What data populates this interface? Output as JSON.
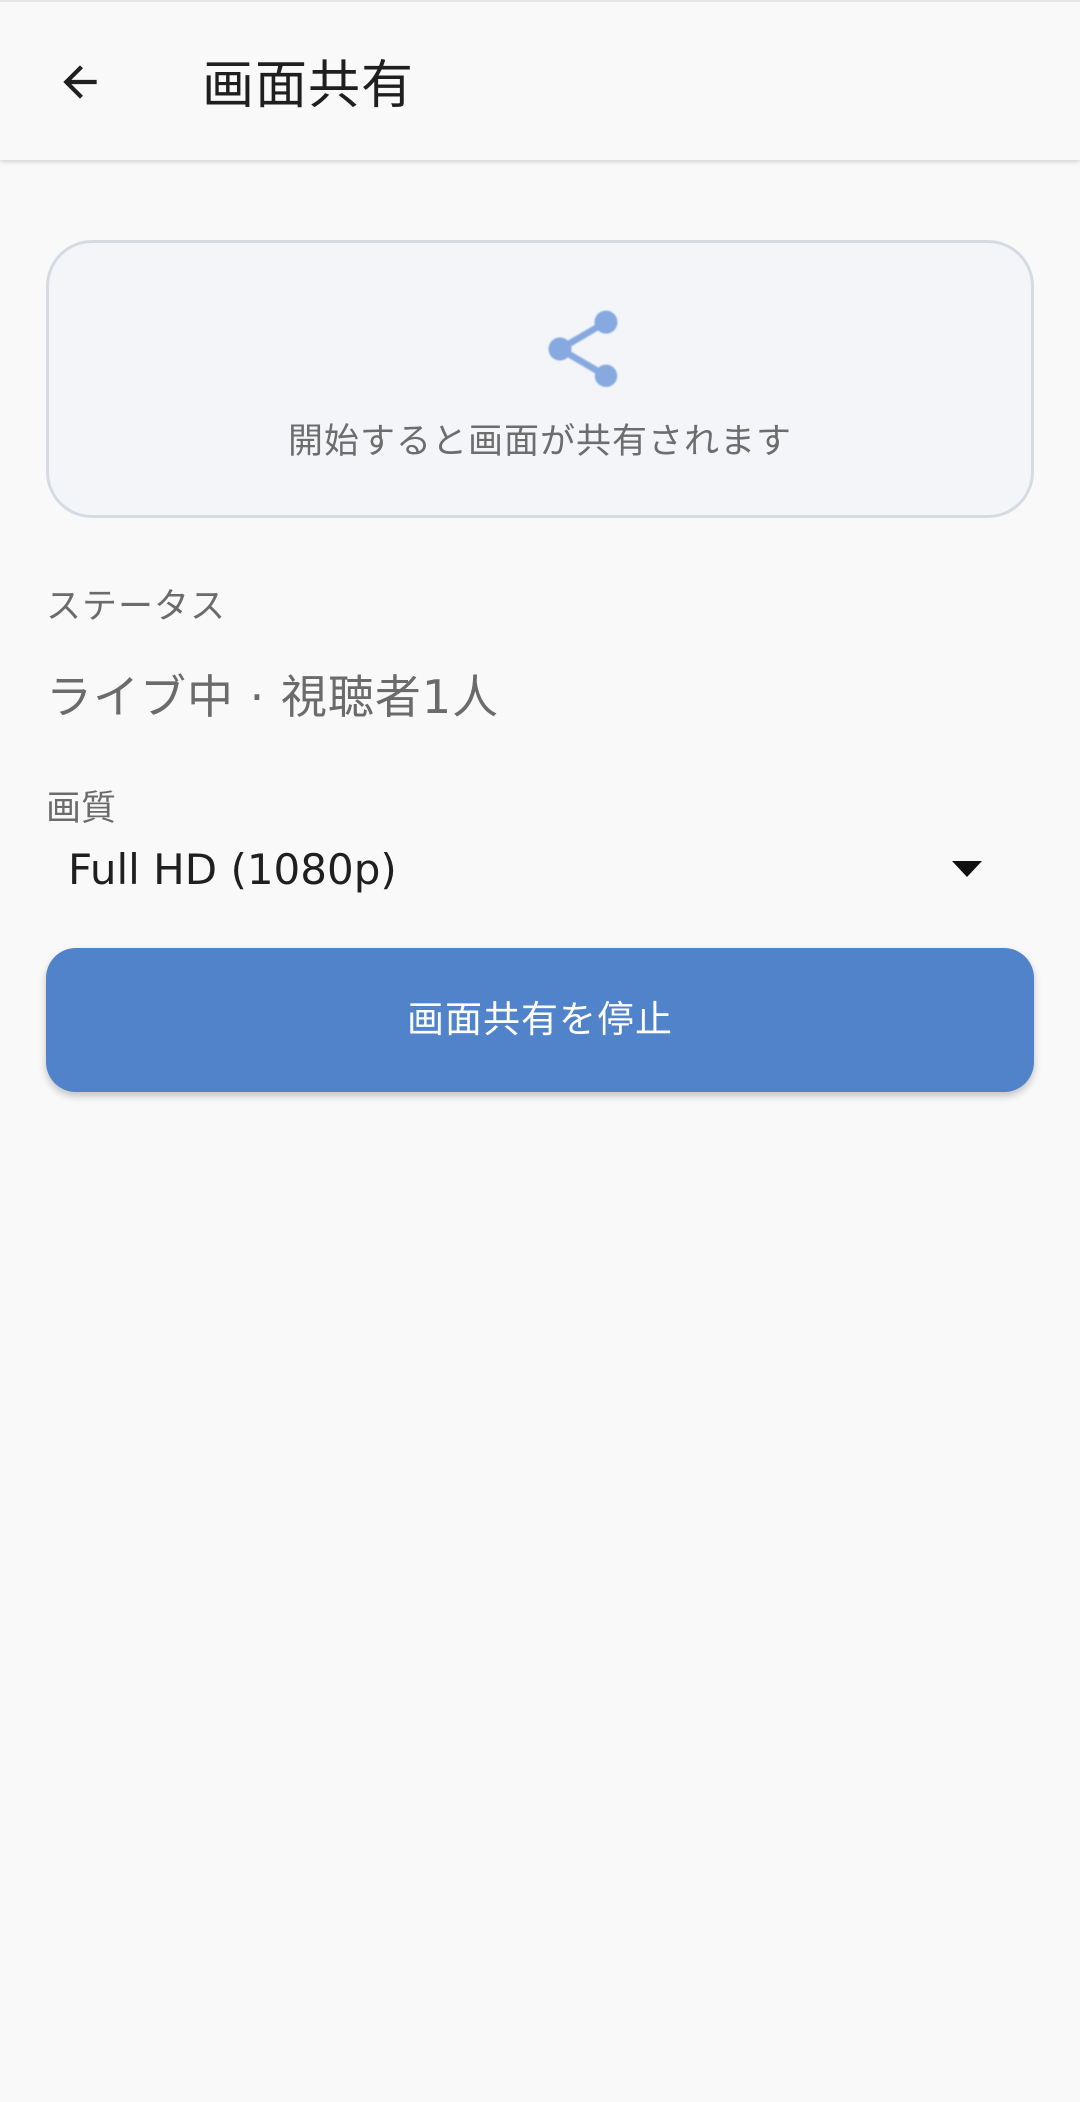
{
  "appbar": {
    "back_icon": "arrow-left-icon",
    "title": "画面共有"
  },
  "preview": {
    "icon": "share-icon",
    "icon_color": "#86a9df",
    "message": "開始すると画面が共有されます"
  },
  "status": {
    "label": "ステータス",
    "value": "ライブ中 · 視聴者1人"
  },
  "quality": {
    "label": "画質",
    "selected": "Full HD (1080p)",
    "dropdown_icon": "caret-down-icon"
  },
  "actions": {
    "stop_label": "画面共有を停止",
    "stop_color": "#5183cb"
  }
}
